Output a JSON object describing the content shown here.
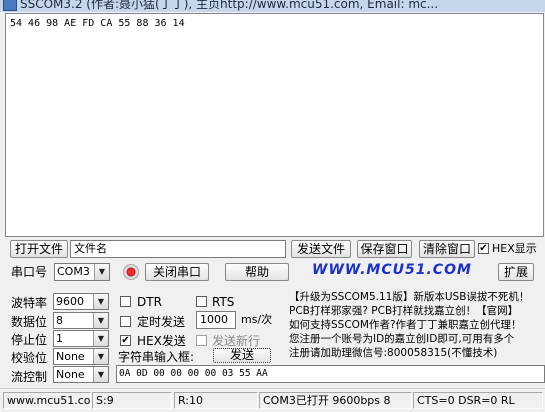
{
  "window": {
    "title": "SSCOM3.2 (作者:聂小猛(丁丁), 主页http://www.mcu51.com, Email: mc..."
  },
  "receive": {
    "text": "54 46 98 AE FD CA 55 88 36 14"
  },
  "row1": {
    "open_file_button": "打开文件",
    "filename_value": "文件名",
    "send_file_button": "发送文件",
    "save_window_button": "保存窗口",
    "clear_window_button": "清除窗口",
    "hex_display_label": "HEX显示",
    "hex_display_checked": true
  },
  "row2": {
    "port_label": "串口号",
    "port_value": "COM3",
    "close_port_button": "关闭串口",
    "help_button": "帮助",
    "logo_text": "WWW.MCU51.COM",
    "expand_button": "扩展"
  },
  "settings": {
    "baud_label": "波特率",
    "baud_value": "9600",
    "databits_label": "数据位",
    "databits_value": "8",
    "stopbits_label": "停止位",
    "stopbits_value": "1",
    "parity_label": "校验位",
    "parity_value": "None",
    "flow_label": "流控制",
    "flow_value": "None"
  },
  "options": {
    "dtr_label": "DTR",
    "rts_label": "RTS",
    "timed_send_label": "定时发送",
    "interval_value": "1000",
    "interval_unit": "ms/次",
    "hex_send_label": "HEX发送",
    "hex_send_checked": true,
    "send_newline_label": "发送新行",
    "input_label": "字符串输入框:",
    "send_button": "发送"
  },
  "ad": {
    "line1": "【升级为SSCOM5.11版】新版本USB误拔不死机！",
    "line2": "PCB打样邪家强? PCB打样就找嘉立创！【官网】",
    "line3": "如何支持SSCOM作者?作者丁丁兼职嘉立创代理！",
    "line4": "您注册一个账号为ID的嘉立创ID即可,可用有多个",
    "line5": "注册请加助理微信号:800058315(不懂技术)"
  },
  "send_input": {
    "value": "0A 0D 00 00 00 00 03 55 AA"
  },
  "statusbar": {
    "website": "www.mcu51.cor",
    "sent": "S:9",
    "received": "R:10",
    "port_status": "COM3已打开  9600bps  8",
    "signals": "CTS=0 DSR=0 RL"
  }
}
